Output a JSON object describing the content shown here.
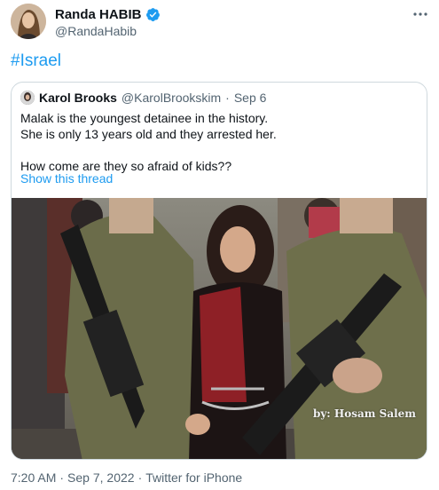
{
  "author": {
    "display_name": "Randa HABIB",
    "handle": "@RandaHabib",
    "verified_icon": "verified-badge-icon",
    "accent": "#1d9bf0"
  },
  "tweet": {
    "text": "#Israel"
  },
  "quoted": {
    "display_name": "Karol Brooks",
    "handle": "@KarolBrookskim",
    "separator": "·",
    "date": "Sep 6",
    "lines": [
      "Malak is the youngest detainee in the history.",
      "She is only 13 years old and they arrested her.",
      "How come are they so afraid of kids??"
    ],
    "show_thread": "Show this thread",
    "photo_credit": "by: Hosam Salem"
  },
  "footer": {
    "time": "7:20 AM",
    "separator": "·",
    "date": "Sep 7, 2022",
    "separator2": "·",
    "source": "Twitter for iPhone"
  },
  "colors": {
    "text": "#0f1419",
    "secondary": "#536471",
    "link": "#1d9bf0",
    "border": "#cfd9de"
  }
}
